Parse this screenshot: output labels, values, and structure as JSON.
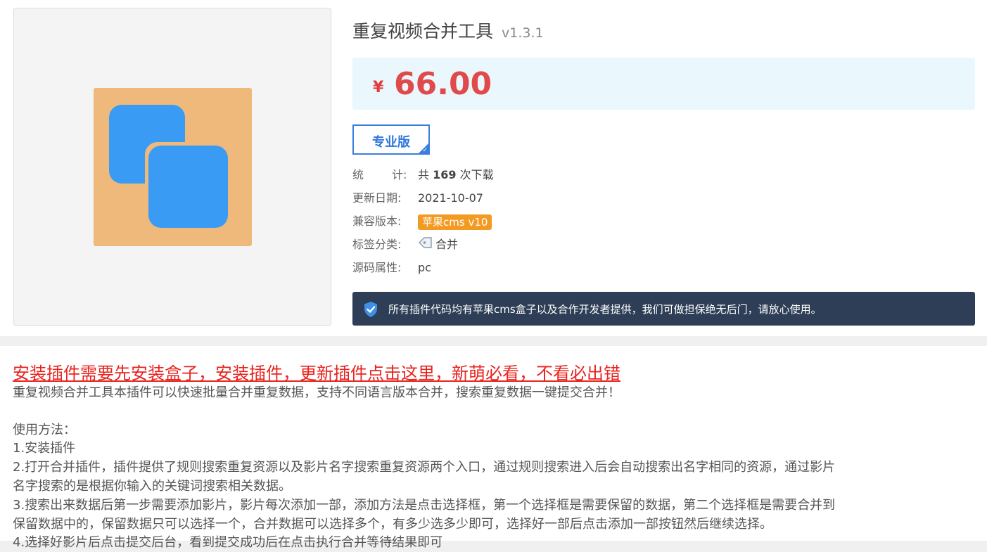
{
  "product": {
    "title": "重复视频合并工具",
    "version": "v1.3.1",
    "currency": "¥",
    "price": "66.00",
    "edition": "专业版",
    "icon": "overlapping-squares-icon",
    "colors": {
      "icon_bg": "#f0b97c",
      "icon_fg": "#3a9bf5",
      "price": "#e04a4a",
      "accent": "#3a7fe0"
    }
  },
  "info": {
    "stats_label_a": "统",
    "stats_label_b": "计:",
    "stats_prefix": "共",
    "downloads": "169",
    "stats_suffix": "次下载",
    "updated_label": "更新日期:",
    "updated_value": "2021-10-07",
    "compat_label": "兼容版本:",
    "compat_value": "苹果cms v10",
    "tags_label": "标签分类:",
    "tags_value": "合并",
    "source_label": "源码属性:",
    "source_value": "pc"
  },
  "notice": {
    "text": "所有插件代码均有苹果cms盒子以及合作开发者提供，我们可做担保绝无后门，请放心使用。",
    "icon": "shield-check-icon"
  },
  "description": {
    "install_link": "安装插件需要先安装盒子，安装插件，更新插件点击这里，新萌必看，不看必出错",
    "intro": "重复视频合并工具本插件可以快速批量合并重复数据，支持不同语言版本合并，搜索重复数据一键提交合并！",
    "usage_title": "使用方法：",
    "step1": "1.安装插件",
    "step2_a": "2.打开合并插件，插件提供了规则搜索重复资源以及影片名字搜索重复资源两个入口，通过规则搜索进入后会自动搜索出名字相同的资源，通过影片",
    "step2_b": "名字搜索的是根据你输入的关键词搜索相关数据。",
    "step3_a": "3.搜索出来数据后第一步需要添加影片，影片每次添加一部，添加方法是点击选择框，第一个选择框是需要保留的数据，第二个选择框是需要合并到",
    "step3_b": "保留数据中的，保留数据只可以选择一个，合并数据可以选择多个，有多少选多少即可，选择好一部后点击添加一部按钮然后继续选择。",
    "step4_partial": "4.选择好影片后点击提交后台，看到提交成功后在点击执行合并等待结果即可"
  }
}
